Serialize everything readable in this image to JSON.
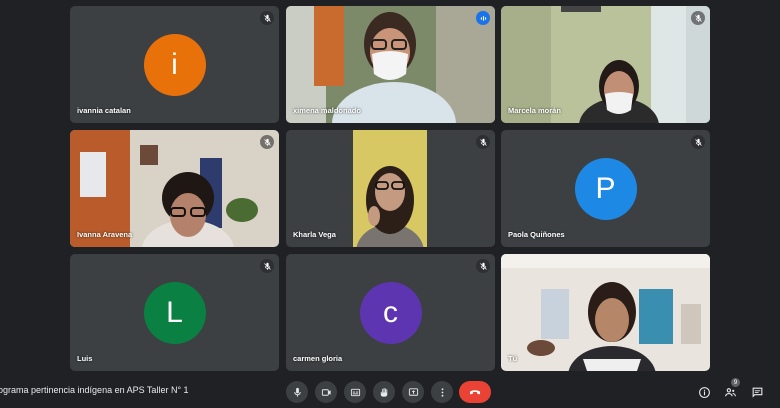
{
  "participants": [
    {
      "name": "ivannia catalan",
      "initial": "i",
      "color": "#e8710a",
      "muted": true
    },
    {
      "name": "ximena maldonado",
      "speaking": true
    },
    {
      "name": "Marcela morán",
      "muted": true
    },
    {
      "name": "Ivanna Aravena",
      "muted": true
    },
    {
      "name": "Kharla Vega",
      "muted": true
    },
    {
      "name": "Paola Quiñones",
      "initial": "P",
      "color": "#1e88e5",
      "muted": true
    },
    {
      "name": "Luis",
      "initial": "L",
      "color": "#0b8043",
      "muted": true
    },
    {
      "name": "carmen gloria",
      "initial": "c",
      "color": "#5e35b1",
      "muted": true
    },
    {
      "name": "Tú"
    }
  ],
  "meeting": {
    "title": "rograma pertinencia indígena en APS Taller N° 1"
  },
  "controls": {
    "mic": "mic-icon",
    "camera": "camera-icon",
    "captions": "captions-icon",
    "hand": "raise-hand-icon",
    "present": "present-icon",
    "more": "more-icon",
    "hangup": "hang-up-icon"
  },
  "right": {
    "people_count": "9"
  },
  "colors": {
    "background": "#202124",
    "tile": "#3c4043",
    "hangup": "#ea4335",
    "accent": "#1a73e8"
  }
}
